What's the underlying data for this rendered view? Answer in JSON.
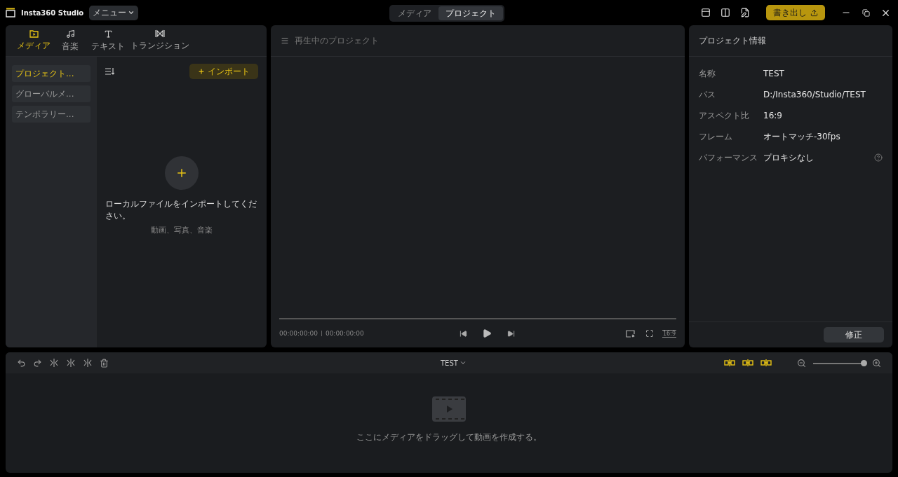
{
  "app": {
    "title": "Insta360 Studio",
    "menu": "メニュー"
  },
  "mode_tabs": [
    {
      "label": "メディア",
      "selected": false
    },
    {
      "label": "プロジェクト",
      "selected": true
    }
  ],
  "export_button": "書き出し",
  "library": {
    "tabs": [
      {
        "kind": "media",
        "label": "メディア",
        "selected": true
      },
      {
        "kind": "music",
        "label": "音楽",
        "selected": false
      },
      {
        "kind": "text",
        "label": "テキスト",
        "selected": false
      },
      {
        "kind": "transition",
        "label": "トランジション",
        "selected": false
      }
    ],
    "folders": [
      {
        "label": "プロジェクト...",
        "selected": true
      },
      {
        "label": "グローバルメ...",
        "selected": false
      },
      {
        "label": "テンポラリー...",
        "selected": false
      }
    ],
    "import_button": "インポート",
    "empty_title": "ローカルファイルをインポートしてください。",
    "empty_subtitle": "動画、写真、音楽"
  },
  "preview": {
    "title": "再生中のプロジェクト",
    "current_time": "00:00:00:00",
    "total_time": "00:00:00:00",
    "ratio": "16:9"
  },
  "info": {
    "title": "プロジェクト情報",
    "rows": [
      {
        "label": "名称",
        "value": "TEST",
        "help": false
      },
      {
        "label": "パス",
        "value": "D:/Insta360/Studio/TEST",
        "help": false
      },
      {
        "label": "アスペクト比",
        "value": "16:9",
        "help": false
      },
      {
        "label": "フレーム",
        "value": "オートマッチ-30fps",
        "help": false
      },
      {
        "label": "パフォーマンス",
        "value": "プロキシなし",
        "help": true
      }
    ],
    "edit_button": "修正"
  },
  "timeline": {
    "project": "TEST",
    "zoom": {
      "level": 0.97
    },
    "empty_text": "ここにメディアをドラッグして動画を作成する。"
  }
}
